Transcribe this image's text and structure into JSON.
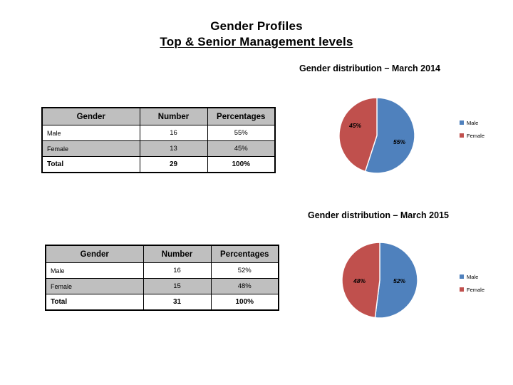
{
  "slide": {
    "title_line1": "Gender Profiles",
    "title_line2": "Top & Senior Management levels",
    "background_color": "#FFFFFF"
  },
  "palette": {
    "male_color": "#4F81BD",
    "female_color": "#C0504D",
    "header_fill": "#BFBFBF",
    "alt_row_fill": "#BFBFBF",
    "border_color": "#000000"
  },
  "sections": [
    {
      "id": "2014",
      "heading": "Gender distribution – March 2014",
      "table": {
        "columns": [
          "Gender",
          "Number",
          "Percentages"
        ],
        "rows": [
          {
            "gender": "Male",
            "number": "16",
            "percentage": "55%"
          },
          {
            "gender": "Female",
            "number": "13",
            "percentage": "45%"
          },
          {
            "gender": "Total",
            "number": "29",
            "percentage": "100%"
          }
        ]
      },
      "chart_data": {
        "type": "pie",
        "title": "Gender distribution – March 2014",
        "categories": [
          "Male",
          "Female"
        ],
        "values": [
          55,
          45
        ],
        "counts": [
          16,
          13
        ],
        "total": 29,
        "data_labels": [
          "55%",
          "45%"
        ],
        "colors": [
          "#4F81BD",
          "#C0504D"
        ],
        "legend": [
          "Male",
          "Female"
        ],
        "legend_position": "right",
        "start_angle_deg": 0,
        "direction": "clockwise"
      }
    },
    {
      "id": "2015",
      "heading": "Gender distribution – March 2015",
      "table": {
        "columns": [
          "Gender",
          "Number",
          "Percentages"
        ],
        "rows": [
          {
            "gender": "Male",
            "number": "16",
            "percentage": "52%"
          },
          {
            "gender": "Female",
            "number": "15",
            "percentage": "48%"
          },
          {
            "gender": "Total",
            "number": "31",
            "percentage": "100%"
          }
        ]
      },
      "chart_data": {
        "type": "pie",
        "title": "Gender distribution – March 2015",
        "categories": [
          "Male",
          "Female"
        ],
        "values": [
          52,
          48
        ],
        "counts": [
          16,
          15
        ],
        "total": 31,
        "data_labels": [
          "52%",
          "48%"
        ],
        "colors": [
          "#4F81BD",
          "#C0504D"
        ],
        "legend": [
          "Male",
          "Female"
        ],
        "legend_position": "right",
        "start_angle_deg": 0,
        "direction": "clockwise"
      }
    }
  ]
}
